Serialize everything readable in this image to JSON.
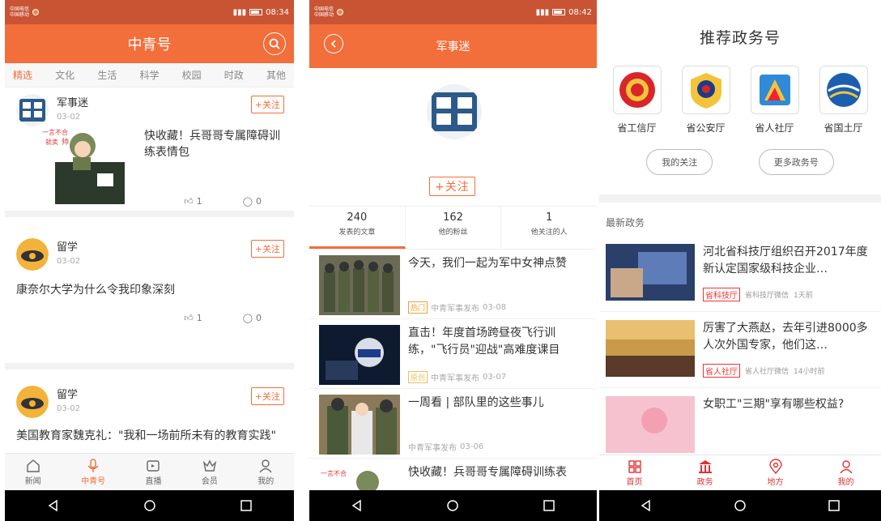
{
  "colors": {
    "accent": "#f26e3a",
    "status": "#c85434",
    "tag_red": "#e33333"
  },
  "panel1": {
    "status": {
      "carrier1": "中国电信",
      "carrier2": "中国移动",
      "time": "08:34"
    },
    "title": "中青号",
    "tabs": [
      "精选",
      "文化",
      "生活",
      "科学",
      "校园",
      "时政",
      "其他"
    ],
    "feed": [
      {
        "name": "军事迷",
        "date": "03-02",
        "follow": "+关注",
        "title": "快收藏！兵哥哥专属障碍训练表情包",
        "likes": "1",
        "comments": "0"
      },
      {
        "name": "留学",
        "date": "03-02",
        "follow": "+关注",
        "title": "康奈尔大学为什么令我印象深刻",
        "likes": "1",
        "comments": "0"
      },
      {
        "name": "留学",
        "date": "03-02",
        "follow": "+关注",
        "title": "美国教育家魏克礼：\"我和一场前所未有的教育实践\""
      }
    ],
    "nav": [
      {
        "label": "新闻",
        "icon": "home-icon"
      },
      {
        "label": "中青号",
        "icon": "mic-icon"
      },
      {
        "label": "直播",
        "icon": "tv-icon"
      },
      {
        "label": "会员",
        "icon": "crown-icon"
      },
      {
        "label": "我的",
        "icon": "person-icon"
      }
    ]
  },
  "panel2": {
    "status": {
      "carrier1": "中国电信",
      "carrier2": "中国移动",
      "time": "08:42"
    },
    "title": "军事迷",
    "follow": "+关注",
    "stats": [
      {
        "n": "240",
        "label": "发表的文章"
      },
      {
        "n": "162",
        "label": "他的粉丝"
      },
      {
        "n": "1",
        "label": "他关注的人"
      }
    ],
    "articles": [
      {
        "title": "今天，我们一起为军中女神点赞",
        "tag": "热门",
        "tag_color": "#f0a030",
        "source": "中青军事发布",
        "date": "03-08"
      },
      {
        "title": "直击！年度首场跨昼夜飞行训练，\"飞行员\"迎战\"高难度课目",
        "tag": "原创",
        "tag_color": "#e8c060",
        "source": "中青军事发布",
        "date": "03-07"
      },
      {
        "title": "一周看 | 部队里的这些事儿",
        "tag": "",
        "tag_color": "",
        "source": "中青军事发布",
        "date": "03-06"
      },
      {
        "title": "快收藏！兵哥哥专属障碍训练表",
        "tag": "",
        "tag_color": "",
        "source": "",
        "date": ""
      }
    ]
  },
  "panel3": {
    "title": "推荐政务号",
    "accounts": [
      "省工信厅",
      "省公安厅",
      "省人社厅",
      "省国土厅"
    ],
    "my_follow": "我的关注",
    "more": "更多政务号",
    "latest": "最新政务",
    "news": [
      {
        "title": "河北省科技厅组织召开2017年度新认定国家级科技企业…",
        "tag": "省科技厅",
        "source": "省科技厅微信",
        "time": "1天前"
      },
      {
        "title": "厉害了大燕赵，去年引进8000多人次外国专家，他们这…",
        "tag": "省人社厅",
        "source": "省人社厅微信",
        "time": "14小时前"
      },
      {
        "title": "女职工\"三期\"享有哪些权益?",
        "tag": "",
        "source": "",
        "time": ""
      }
    ],
    "nav": [
      {
        "label": "首页",
        "icon": "grid-icon"
      },
      {
        "label": "政务",
        "icon": "gov-building-icon"
      },
      {
        "label": "地方",
        "icon": "location-icon"
      },
      {
        "label": "我的",
        "icon": "person-icon"
      }
    ]
  }
}
